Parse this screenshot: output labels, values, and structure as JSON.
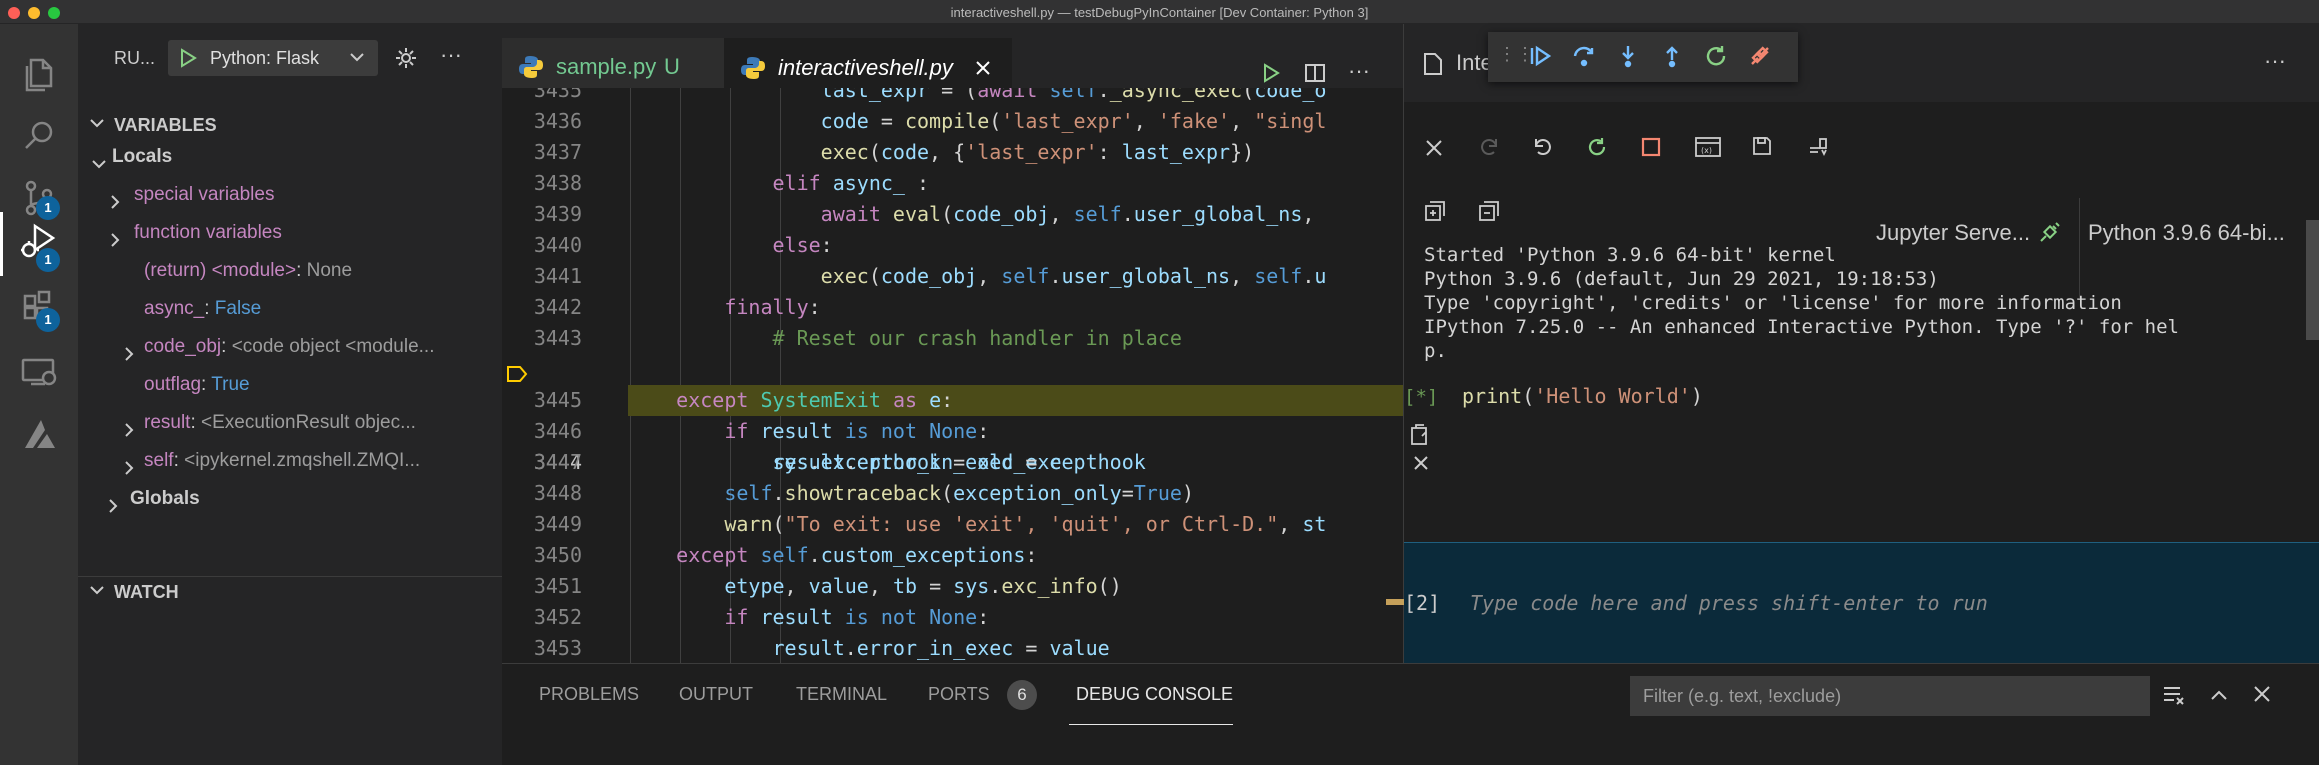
{
  "window": {
    "title": "interactiveshell.py — testDebugPyInContainer [Dev Container: Python 3]"
  },
  "activity": {
    "badges": [
      "1",
      "1",
      "1"
    ]
  },
  "run": {
    "title": "RU...",
    "config": "Python: Flask"
  },
  "variables": {
    "title": "VARIABLES",
    "locals_label": "Locals",
    "rows": [
      {
        "name": "special variables",
        "sep": "",
        "value": ""
      },
      {
        "name": "function variables",
        "sep": "",
        "value": ""
      },
      {
        "name": "(return) <module>",
        "sep": ": ",
        "value": "None"
      },
      {
        "name": "async_",
        "sep": ": ",
        "value": "False"
      },
      {
        "name": "code_obj",
        "sep": ": ",
        "value": "<code object <module..."
      },
      {
        "name": "outflag",
        "sep": ": ",
        "value": "True"
      },
      {
        "name": "result",
        "sep": ": ",
        "value": "<ExecutionResult objec..."
      },
      {
        "name": "self",
        "sep": ": ",
        "value": "<ipykernel.zmqshell.ZMQI..."
      }
    ],
    "globals_label": "Globals"
  },
  "watch": {
    "title": "WATCH"
  },
  "tabs": [
    {
      "name": "sample.py",
      "status": "U"
    },
    {
      "name": "interactiveshell.py",
      "status": ""
    }
  ],
  "editor": {
    "lines": [
      "3435",
      "3436",
      "3437",
      "3438",
      "3439",
      "3440",
      "3441",
      "3442",
      "3443",
      "3444",
      "3445",
      "3446",
      "3447",
      "3448",
      "3449",
      "3450",
      "3451",
      "3452",
      "3453"
    ],
    "current_line": "3444"
  },
  "interactive": {
    "tab_name": "Inte",
    "kernel_server": "Jupyter Serve...",
    "kernel_name": "Python 3.9.6 64-bi...",
    "output": [
      "Started 'Python 3.9.6 64-bit' kernel",
      "Python 3.9.6 (default, Jun 29 2021, 19:18:53)",
      "Type 'copyright', 'credits' or 'license' for more information",
      "IPython 7.25.0 -- An enhanced Interactive Python. Type '?' for hel",
      "p."
    ],
    "cell_prompt": "[*]",
    "cell_code_fn": "print",
    "cell_code_open": "(",
    "cell_code_str": "'Hello World'",
    "cell_code_close": ")",
    "input_prompt": "[2]",
    "input_placeholder": "Type code here and press shift-enter to run"
  },
  "panel": {
    "tabs": [
      "PROBLEMS",
      "OUTPUT",
      "TERMINAL",
      "PORTS",
      "DEBUG CONSOLE"
    ],
    "ports_badge": "6",
    "active_tab": "DEBUG CONSOLE",
    "filter_placeholder": "Filter (e.g. text, !exclude)"
  }
}
